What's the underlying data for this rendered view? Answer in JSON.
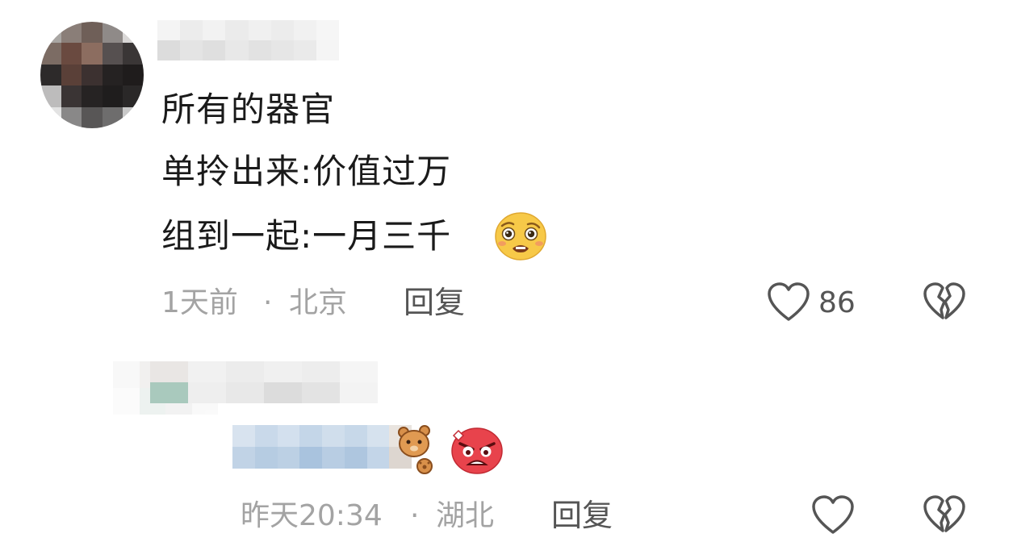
{
  "comments": [
    {
      "username": "",
      "lines": [
        "所有的器官",
        "单拎出来:价值过万",
        "组到一起:一月三千"
      ],
      "emoji_icon": "pleading-face-icon",
      "time": "1天前",
      "separator": "·",
      "location": "北京",
      "reply_label": "回复",
      "likes": "86",
      "like_icon": "heart-outline-icon",
      "dislike_icon": "broken-heart-icon"
    },
    {
      "username": "",
      "time": "昨天20:34",
      "separator": "·",
      "location": "湖北",
      "reply_label": "回复",
      "emoji_icons": [
        "bear-sticker-icon",
        "angry-face-icon"
      ],
      "like_icon": "heart-outline-icon",
      "dislike_icon": "broken-heart-icon"
    }
  ],
  "colors": {
    "text": "#1a1a1a",
    "meta": "#a3a3a3",
    "icon": "#555555",
    "angry": "#e8434c",
    "emoji": "#f7c948"
  }
}
